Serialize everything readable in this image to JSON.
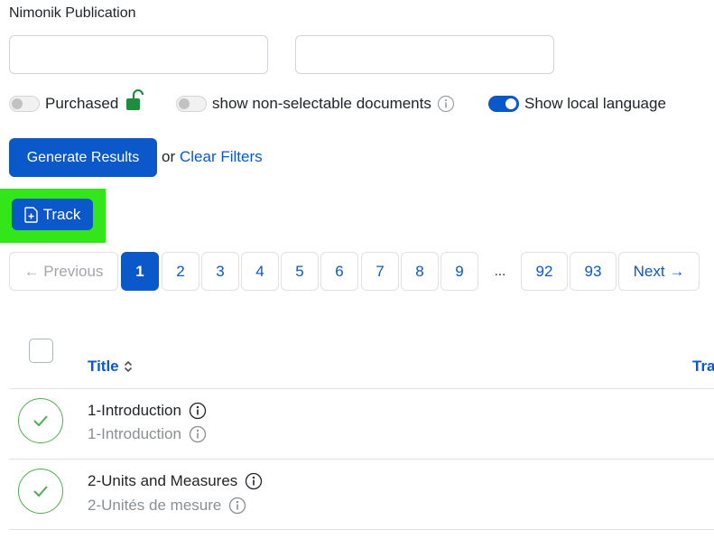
{
  "publication": {
    "label": "Nimonik Publication"
  },
  "toggles": {
    "purchased": {
      "label": "Purchased",
      "state": "off",
      "lock_icon": "unlocked-lock-icon",
      "lock_color": "#1e8e3e"
    },
    "non_selectable": {
      "label": "show non-selectable documents",
      "state": "off",
      "info_icon": "info-icon"
    },
    "local_language": {
      "label": "Show local language",
      "state": "on"
    }
  },
  "actions": {
    "generate_label": "Generate Results",
    "or_text": "or",
    "clear_label": "Clear Filters",
    "track_label": "Track",
    "track_icon": "file-plus-icon"
  },
  "pagination": {
    "previous_label": "← Previous",
    "pages": [
      "1",
      "2",
      "3",
      "4",
      "5",
      "6",
      "7",
      "8",
      "9"
    ],
    "active_page": "1",
    "ellipsis": "...",
    "last_pages": [
      "92",
      "93"
    ],
    "next_label": "Next →"
  },
  "table": {
    "columns": {
      "title": "Title",
      "next_col_partial": "Tra"
    },
    "rows": [
      {
        "title": "1-Introduction",
        "subtitle": "1-Introduction",
        "status": "selected"
      },
      {
        "title": "2-Units and Measures",
        "subtitle": "2-Unités de mesure",
        "status": "selected"
      }
    ]
  },
  "colors": {
    "accent": "#0a58ca",
    "highlight": "#33e61a",
    "success": "#4caf50"
  }
}
